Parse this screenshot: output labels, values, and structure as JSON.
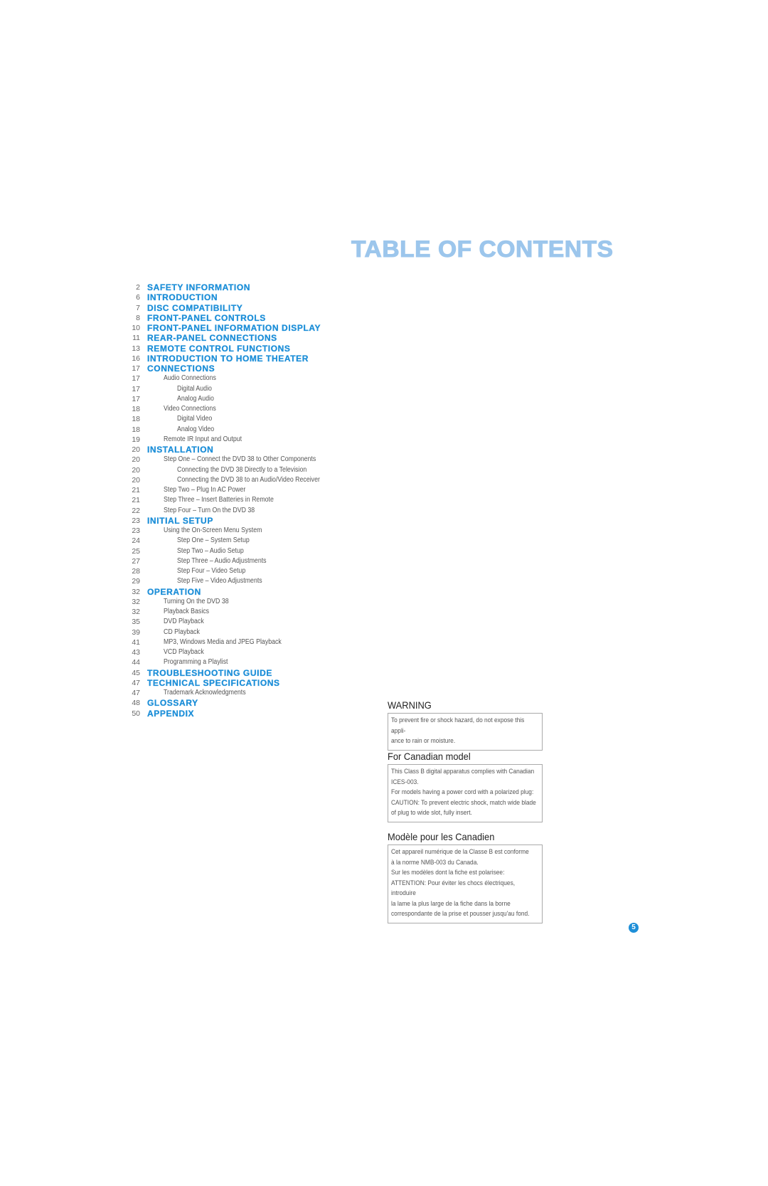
{
  "title": "TABLE OF CONTENTS",
  "toc": [
    {
      "page": "2",
      "label": "SAFETY INFORMATION",
      "level": "major"
    },
    {
      "page": "6",
      "label": "INTRODUCTION",
      "level": "major"
    },
    {
      "page": "7",
      "label": "DISC COMPATIBILITY",
      "level": "major"
    },
    {
      "page": "8",
      "label": "FRONT-PANEL CONTROLS",
      "level": "major"
    },
    {
      "page": "10",
      "label": "FRONT-PANEL INFORMATION DISPLAY",
      "level": "major"
    },
    {
      "page": "11",
      "label": "REAR-PANEL CONNECTIONS",
      "level": "major"
    },
    {
      "page": "13",
      "label": "REMOTE CONTROL FUNCTIONS",
      "level": "major"
    },
    {
      "page": "16",
      "label": "INTRODUCTION TO HOME THEATER",
      "level": "major"
    },
    {
      "page": "17",
      "label": "CONNECTIONS",
      "level": "major"
    },
    {
      "page": "17",
      "label": "Audio Connections",
      "level": "l1"
    },
    {
      "page": "17",
      "label": "Digital Audio",
      "level": "l2"
    },
    {
      "page": "17",
      "label": "Analog Audio",
      "level": "l2"
    },
    {
      "page": "18",
      "label": "Video Connections",
      "level": "l1"
    },
    {
      "page": "18",
      "label": "Digital Video",
      "level": "l2"
    },
    {
      "page": "18",
      "label": "Analog Video",
      "level": "l2"
    },
    {
      "page": "19",
      "label": "Remote IR Input and Output",
      "level": "l1"
    },
    {
      "page": "20",
      "label": "INSTALLATION",
      "level": "major"
    },
    {
      "page": "20",
      "label": "Step One – Connect the DVD 38 to Other Components",
      "level": "l1"
    },
    {
      "page": "20",
      "label": "Connecting the DVD 38 Directly to a Television",
      "level": "l2"
    },
    {
      "page": "20",
      "label": "Connecting the DVD 38 to an Audio/Video Receiver",
      "level": "l2"
    },
    {
      "page": "21",
      "label": "Step Two – Plug In AC Power",
      "level": "l1"
    },
    {
      "page": "21",
      "label": "Step Three – Insert Batteries in Remote",
      "level": "l1"
    },
    {
      "page": "22",
      "label": "Step Four – Turn On the DVD 38",
      "level": "l1"
    },
    {
      "page": "23",
      "label": "INITIAL SETUP",
      "level": "major"
    },
    {
      "page": "23",
      "label": "Using the On-Screen Menu System",
      "level": "l1"
    },
    {
      "page": "24",
      "label": "Step One – System Setup",
      "level": "l2"
    },
    {
      "page": "25",
      "label": "Step Two – Audio Setup",
      "level": "l2"
    },
    {
      "page": "27",
      "label": "Step Three – Audio Adjustments",
      "level": "l2"
    },
    {
      "page": "28",
      "label": "Step Four – Video Setup",
      "level": "l2"
    },
    {
      "page": "29",
      "label": "Step Five – Video Adjustments",
      "level": "l2"
    },
    {
      "page": "32",
      "label": "OPERATION",
      "level": "major"
    },
    {
      "page": "32",
      "label": "Turning On the DVD 38",
      "level": "l1"
    },
    {
      "page": "32",
      "label": "Playback Basics",
      "level": "l1"
    },
    {
      "page": "35",
      "label": "DVD Playback",
      "level": "l1"
    },
    {
      "page": "39",
      "label": "CD Playback",
      "level": "l1"
    },
    {
      "page": "41",
      "label": "MP3, Windows Media and JPEG Playback",
      "level": "l1"
    },
    {
      "page": "43",
      "label": "VCD Playback",
      "level": "l1"
    },
    {
      "page": "44",
      "label": "Programming a Playlist",
      "level": "l1"
    },
    {
      "page": "45",
      "label": "TROUBLESHOOTING GUIDE",
      "level": "major"
    },
    {
      "page": "47",
      "label": "TECHNICAL SPECIFICATIONS",
      "level": "major"
    },
    {
      "page": "47",
      "label": "Trademark Acknowledgments",
      "level": "l1"
    },
    {
      "page": "48",
      "label": "GLOSSARY",
      "level": "major"
    },
    {
      "page": "50",
      "label": "APPENDIX",
      "level": "major"
    }
  ],
  "notices": {
    "warning": {
      "heading": "WARNING",
      "lines": [
        "To prevent fire or shock hazard, do not expose this appli-",
        "ance to rain or moisture."
      ]
    },
    "canadian": {
      "heading": "For Canadian model",
      "lines": [
        "This Class B digital apparatus complies with Canadian",
        "ICES-003.",
        "For models having a power cord with a polarized plug:",
        "CAUTION: To prevent electric shock, match wide blade",
        "of plug to wide slot, fully insert."
      ]
    },
    "french": {
      "heading": "Modèle pour les Canadien",
      "lines": [
        "Cet appareil numérique de la Classe B est conforme",
        "à la norme NMB-003 du Canada.",
        "Sur les modèles dont la fiche est polarisee:",
        "ATTENTION: Pour éviter les chocs électriques, introduire",
        "la lame la plus large de la fiche dans la borne",
        "correspondante de la prise et pousser jusqu'au fond."
      ]
    }
  },
  "page_number": "5",
  "colors": {
    "title": "#9cc6ec",
    "heading": "#1e8fd8",
    "badge": "#1e8fd8"
  }
}
